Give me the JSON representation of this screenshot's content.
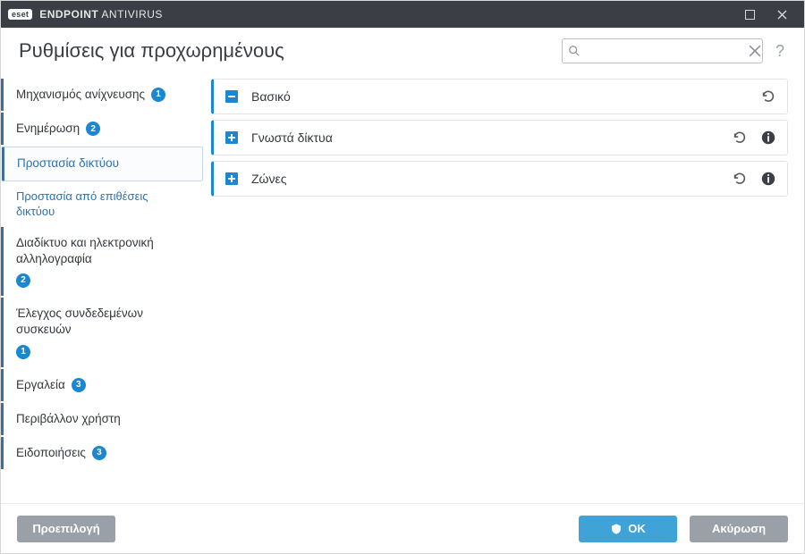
{
  "titlebar": {
    "logo": "eset",
    "product_left": "ENDPOINT",
    "product_right": "ANTIVIRUS"
  },
  "header": {
    "title": "Ρυθμίσεις για προχωρημένους",
    "search_placeholder": ""
  },
  "sidebar": {
    "items": [
      {
        "label": "Μηχανισμός ανίχνευσης",
        "badge": "1",
        "active": false
      },
      {
        "label": "Ενημέρωση",
        "badge": "2",
        "active": false
      },
      {
        "label": "Προστασία δικτύου",
        "badge": null,
        "active": true
      },
      {
        "label": "Προστασία από επιθέσεις δικτύου",
        "badge": null,
        "active": false,
        "sub": true
      },
      {
        "label": "Διαδίκτυο και ηλεκτρονική αλληλογραφία",
        "badge": "2",
        "active": false
      },
      {
        "label": "Έλεγχος συνδεδεμένων συσκευών",
        "badge": "1",
        "active": false
      },
      {
        "label": "Εργαλεία",
        "badge": "3",
        "active": false
      },
      {
        "label": "Περιβάλλον χρήστη",
        "badge": null,
        "active": false
      },
      {
        "label": "Ειδοποιήσεις",
        "badge": "3",
        "active": false
      }
    ]
  },
  "panels": [
    {
      "title": "Βασικό",
      "expanded": true,
      "info": false
    },
    {
      "title": "Γνωστά δίκτυα",
      "expanded": false,
      "info": true
    },
    {
      "title": "Ζώνες",
      "expanded": false,
      "info": true
    }
  ],
  "footer": {
    "default": "Προεπιλογή",
    "ok": "ΟΚ",
    "cancel": "Ακύρωση"
  },
  "colors": {
    "accent": "#1c87d0",
    "titlebar": "#3b3f45",
    "ok": "#3fa3d8",
    "gray": "#9aa0a8"
  }
}
